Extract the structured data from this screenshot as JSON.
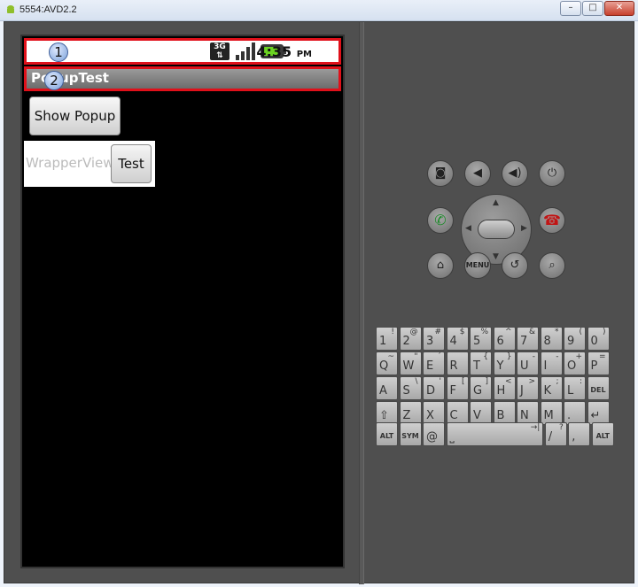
{
  "window": {
    "title": "5554:AVD2.2",
    "min_label": "–",
    "max_label": "□",
    "close_label": "✕"
  },
  "status_bar": {
    "net_label": "3G",
    "time": "4:35",
    "ampm": "PM",
    "marker": "1"
  },
  "app_title_bar": {
    "title": "PopupTest",
    "marker": "2"
  },
  "content": {
    "show_popup_label": "Show Popup",
    "wrapper_label": "WrapperView",
    "test_label": "Test"
  },
  "hardware": {
    "menu_label": "MENU"
  },
  "keyboard": {
    "row1": [
      {
        "main": "1",
        "sec": "!"
      },
      {
        "main": "2",
        "sec": "@"
      },
      {
        "main": "3",
        "sec": "#"
      },
      {
        "main": "4",
        "sec": "$"
      },
      {
        "main": "5",
        "sec": "%"
      },
      {
        "main": "6",
        "sec": "^"
      },
      {
        "main": "7",
        "sec": "&"
      },
      {
        "main": "8",
        "sec": "*"
      },
      {
        "main": "9",
        "sec": "("
      },
      {
        "main": "0",
        "sec": ")"
      }
    ],
    "row2": [
      {
        "main": "Q",
        "sec": "~"
      },
      {
        "main": "W",
        "sec": "\""
      },
      {
        "main": "E",
        "sec": "´"
      },
      {
        "main": "R",
        "sec": ""
      },
      {
        "main": "T",
        "sec": "{"
      },
      {
        "main": "Y",
        "sec": "}"
      },
      {
        "main": "U",
        "sec": "-"
      },
      {
        "main": "I",
        "sec": "-"
      },
      {
        "main": "O",
        "sec": "+"
      },
      {
        "main": "P",
        "sec": "="
      }
    ],
    "row3": [
      {
        "main": "A",
        "sec": ""
      },
      {
        "main": "S",
        "sec": "\\"
      },
      {
        "main": "D",
        "sec": "'"
      },
      {
        "main": "F",
        "sec": "["
      },
      {
        "main": "G",
        "sec": "]"
      },
      {
        "main": "H",
        "sec": "<"
      },
      {
        "main": "J",
        "sec": ">"
      },
      {
        "main": "K",
        "sec": ";"
      },
      {
        "main": "L",
        "sec": ":"
      },
      {
        "main": "DEL",
        "sec": ""
      }
    ],
    "row4": [
      {
        "main": "⇧",
        "sec": ""
      },
      {
        "main": "Z",
        "sec": ""
      },
      {
        "main": "X",
        "sec": ""
      },
      {
        "main": "C",
        "sec": ""
      },
      {
        "main": "V",
        "sec": ""
      },
      {
        "main": "B",
        "sec": ""
      },
      {
        "main": "N",
        "sec": ""
      },
      {
        "main": "M",
        "sec": ""
      },
      {
        "main": ".",
        "sec": ""
      },
      {
        "main": "↵",
        "sec": ""
      }
    ],
    "row5": [
      {
        "main": "ALT",
        "sec": ""
      },
      {
        "main": "SYM",
        "sec": ""
      },
      {
        "main": "@",
        "sec": ""
      },
      {
        "main": "⎵",
        "sec": "→|"
      },
      {
        "main": "/",
        "sec": "?"
      },
      {
        "main": ",",
        "sec": ""
      },
      {
        "main": "ALT",
        "sec": ""
      }
    ]
  }
}
